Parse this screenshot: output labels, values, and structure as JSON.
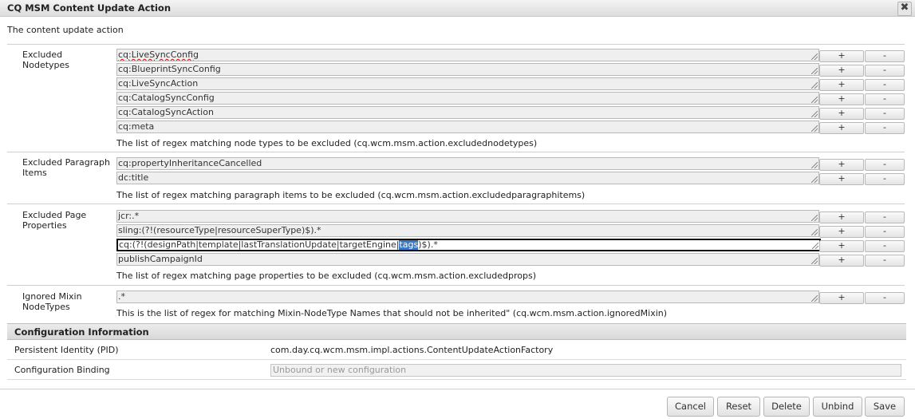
{
  "window": {
    "title": "CQ MSM Content Update Action",
    "close_glyph": "✖"
  },
  "description": "The content update action",
  "sections": [
    {
      "label": "Excluded Nodetypes",
      "values": [
        "cq:LiveSyncConfig",
        "cq:BlueprintSyncConfig",
        "cq:LiveSyncAction",
        "cq:CatalogSyncConfig",
        "cq:CatalogSyncAction",
        "cq:meta"
      ],
      "hint": "The list of regex matching node types to be excluded (cq.wcm.msm.action.excludednodetypes)"
    },
    {
      "label": "Excluded Paragraph Items",
      "values": [
        "cq:propertyInheritanceCancelled",
        "dc:title"
      ],
      "hint": "The list of regex matching paragraph items to be excluded (cq.wcm.msm.action.excludedparagraphitems)"
    },
    {
      "label": "Excluded Page Properties",
      "values": [
        "jcr:.*",
        "sling:(?!(resourceType|resourceSuperType)$).*",
        "cq:(?!(designPath|template|lastTranslationUpdate|targetEngine|tags)$).*",
        "publishCampaignId"
      ],
      "focused_value_prefix": "cq:(?!(designPath|template|lastTranslationUpdate|targetEngine|",
      "focused_value_selected": "tags",
      "focused_value_suffix": ")$).*",
      "hint": "The list of regex matching page properties to be excluded (cq.wcm.msm.action.excludedprops)"
    },
    {
      "label": "Ignored Mixin NodeTypes",
      "values": [
        ".*"
      ],
      "hint": "This is the list of regex for matching Mixin-NodeType Names that should not be inherited\" (cq.wcm.msm.action.ignoredMixin)"
    }
  ],
  "row_buttons": {
    "add": "+",
    "remove": "-"
  },
  "config_info": {
    "header": "Configuration Information",
    "pid_label": "Persistent Identity (PID)",
    "pid_value": "com.day.cq.wcm.msm.impl.actions.ContentUpdateActionFactory",
    "binding_label": "Configuration Binding",
    "binding_placeholder": "Unbound or new configuration"
  },
  "footer": {
    "cancel": "Cancel",
    "reset": "Reset",
    "delete": "Delete",
    "unbind": "Unbind",
    "save": "Save"
  }
}
